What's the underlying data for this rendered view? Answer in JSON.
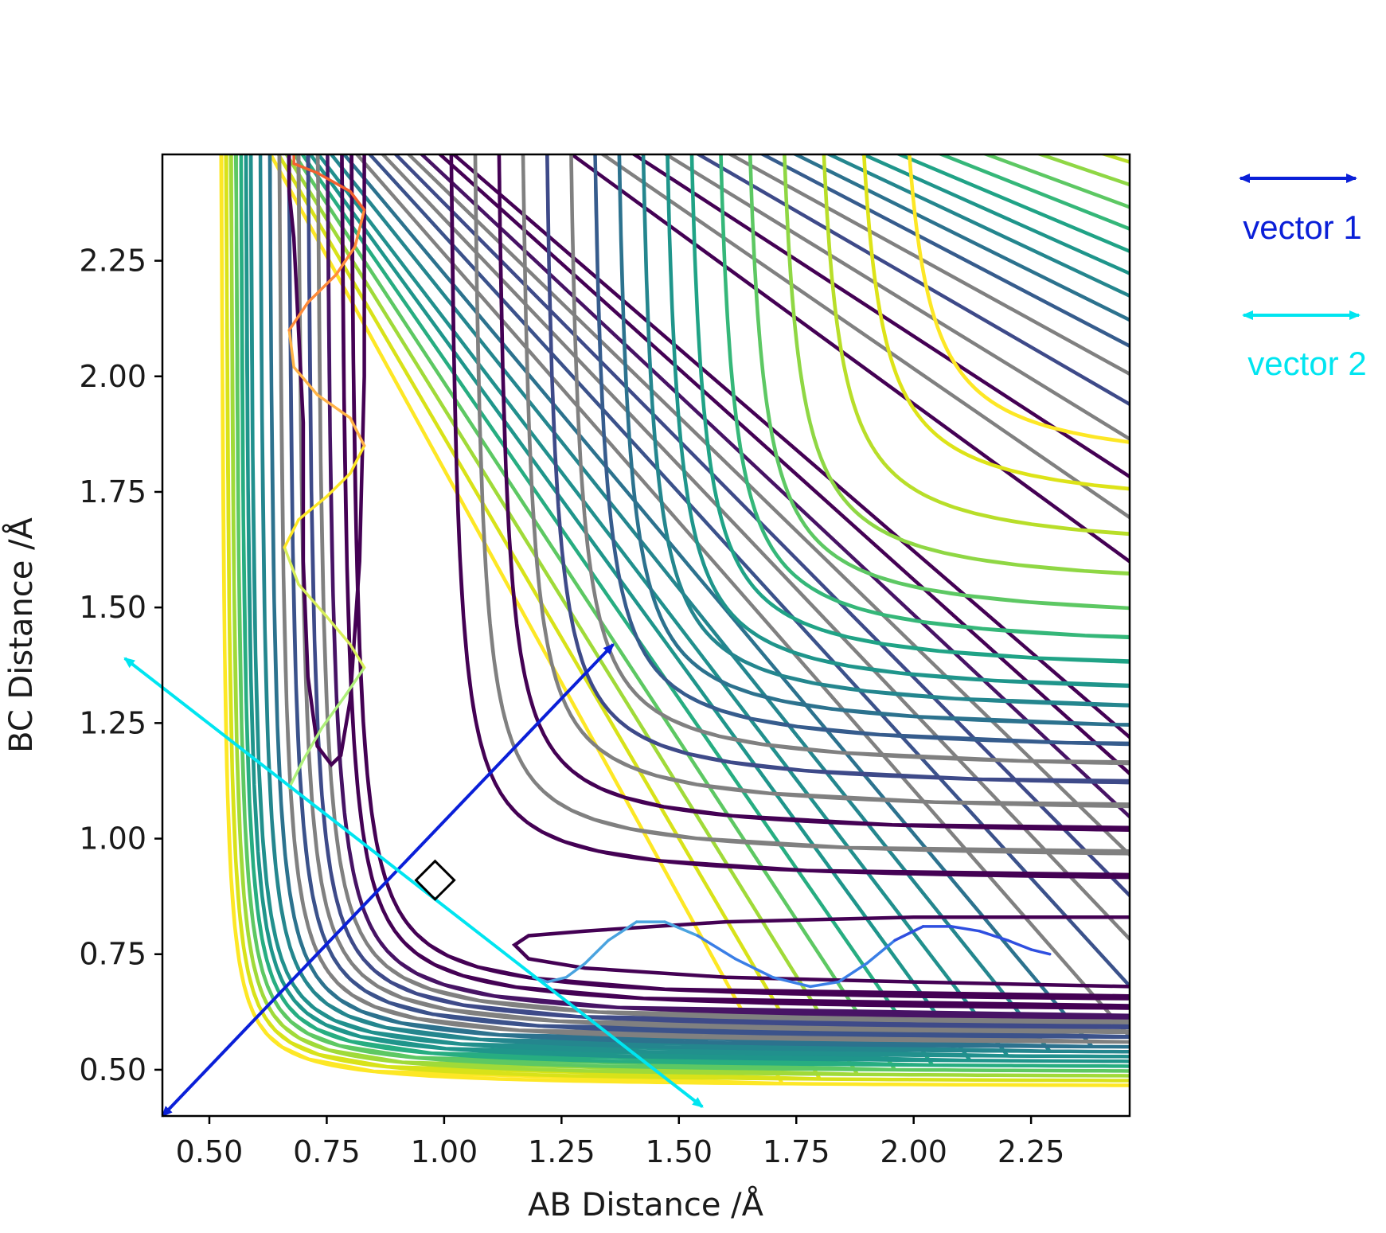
{
  "chart_data": {
    "type": "contour",
    "xlabel": "AB Distance /Å",
    "ylabel": "BC Distance /Å",
    "xlim": [
      0.4,
      2.46
    ],
    "ylim": [
      0.4,
      2.48
    ],
    "x_ticks": [
      "0.50",
      "0.75",
      "1.00",
      "1.25",
      "1.50",
      "1.75",
      "2.00",
      "2.25"
    ],
    "y_ticks": [
      "0.50",
      "0.75",
      "1.00",
      "1.25",
      "1.50",
      "1.75",
      "2.00",
      "2.25"
    ],
    "grid": false,
    "colormap": [
      "#440154",
      "#3b528b",
      "#21908d",
      "#5dc863",
      "#fde725"
    ],
    "contour_levels": [
      {
        "x_asym": 0.52,
        "y_asym": 0.46,
        "color": "#fde725"
      },
      {
        "x_asym": 0.53,
        "y_asym": 0.47,
        "color": "#d8e219"
      },
      {
        "x_asym": 0.54,
        "y_asym": 0.48,
        "color": "#a0da39"
      },
      {
        "x_asym": 0.55,
        "y_asym": 0.49,
        "color": "#5dc863"
      },
      {
        "x_asym": 0.56,
        "y_asym": 0.5,
        "color": "#27ad81"
      },
      {
        "x_asym": 0.57,
        "y_asym": 0.51,
        "color": "#1f958b"
      },
      {
        "x_asym": 0.58,
        "y_asym": 0.52,
        "color": "#21908d"
      },
      {
        "x_asym": 0.6,
        "y_asym": 0.53,
        "color": "#24868e"
      },
      {
        "x_asym": 0.62,
        "y_asym": 0.54,
        "color": "#2c728e"
      },
      {
        "x_asym": 0.64,
        "y_asym": 0.55,
        "color": "#808080"
      },
      {
        "x_asym": 0.66,
        "y_asym": 0.56,
        "color": "#3b528b"
      },
      {
        "x_asym": 0.68,
        "y_asym": 0.57,
        "color": "#808080"
      },
      {
        "x_asym": 0.7,
        "y_asym": 0.58,
        "color": "#3e4a89"
      },
      {
        "x_asym": 0.72,
        "y_asym": 0.59,
        "color": "#808080"
      },
      {
        "x_asym": 0.74,
        "y_asym": 0.6,
        "color": "#471365"
      },
      {
        "x_asym": 0.77,
        "y_asym": 0.62,
        "color": "#440154"
      },
      {
        "x_asym": 0.79,
        "y_asym": 0.64,
        "color": "#440154"
      },
      {
        "x_asym": 1.0,
        "y_asym": 0.9,
        "color": "#440154"
      },
      {
        "x_asym": 1.05,
        "y_asym": 0.95,
        "color": "#808080"
      },
      {
        "x_asym": 1.1,
        "y_asym": 1.0,
        "color": "#440154"
      },
      {
        "x_asym": 1.15,
        "y_asym": 1.05,
        "color": "#808080"
      },
      {
        "x_asym": 1.2,
        "y_asym": 1.1,
        "color": "#3e4a89"
      },
      {
        "x_asym": 1.25,
        "y_asym": 1.14,
        "color": "#808080"
      },
      {
        "x_asym": 1.3,
        "y_asym": 1.18,
        "color": "#365c8d"
      },
      {
        "x_asym": 1.35,
        "y_asym": 1.22,
        "color": "#2c728e"
      },
      {
        "x_asym": 1.4,
        "y_asym": 1.26,
        "color": "#24868e"
      },
      {
        "x_asym": 1.45,
        "y_asym": 1.3,
        "color": "#1f958b"
      },
      {
        "x_asym": 1.5,
        "y_asym": 1.35,
        "color": "#20a386"
      },
      {
        "x_asym": 1.56,
        "y_asym": 1.4,
        "color": "#35b779"
      },
      {
        "x_asym": 1.62,
        "y_asym": 1.46,
        "color": "#5dc863"
      },
      {
        "x_asym": 1.69,
        "y_asym": 1.53,
        "color": "#8fd744"
      },
      {
        "x_asym": 1.77,
        "y_asym": 1.61,
        "color": "#b8de29"
      },
      {
        "x_asym": 1.85,
        "y_asym": 1.7,
        "color": "#dde318"
      },
      {
        "x_asym": 1.94,
        "y_asym": 1.79,
        "color": "#fde725"
      }
    ],
    "trajectory_1": {
      "x": [
        0.67,
        0.7,
        0.74,
        0.79,
        0.83,
        0.8,
        0.75,
        0.69,
        0.66,
        0.69,
        0.75,
        0.8,
        0.83,
        0.8,
        0.73,
        0.68,
        0.67,
        0.71,
        0.77,
        0.81,
        0.83,
        0.8,
        0.73,
        0.68,
        0.68
      ],
      "y": [
        1.11,
        1.17,
        1.24,
        1.31,
        1.37,
        1.42,
        1.48,
        1.55,
        1.63,
        1.69,
        1.74,
        1.79,
        1.85,
        1.91,
        1.96,
        2.02,
        2.1,
        2.16,
        2.22,
        2.28,
        2.36,
        2.4,
        2.44,
        2.46,
        2.48
      ],
      "colors": [
        "#aef07a",
        "#d8ef5a",
        "#fde725",
        "#ffb347",
        "#ff8c3a",
        "#f5612f"
      ]
    },
    "trajectory_2": {
      "x": [
        1.19,
        1.22,
        1.26,
        1.3,
        1.35,
        1.41,
        1.47,
        1.54,
        1.62,
        1.7,
        1.78,
        1.84,
        1.9,
        1.96,
        2.02,
        2.08,
        2.14,
        2.2,
        2.25,
        2.29
      ],
      "y": [
        0.7,
        0.69,
        0.7,
        0.73,
        0.78,
        0.82,
        0.82,
        0.79,
        0.74,
        0.7,
        0.68,
        0.69,
        0.73,
        0.78,
        0.81,
        0.81,
        0.8,
        0.78,
        0.76,
        0.75
      ],
      "colors": [
        "#4aa3df",
        "#3a7ee6",
        "#2f4fe0"
      ]
    },
    "vectors": [
      {
        "name": "vector 1",
        "color": "#0a1fd8",
        "start": [
          0.4,
          0.4
        ],
        "end": [
          1.36,
          1.42
        ]
      },
      {
        "name": "vector 2",
        "color": "#00e5f0",
        "start": [
          0.32,
          1.39
        ],
        "end": [
          1.55,
          0.42
        ]
      }
    ],
    "right_angle_marker": {
      "at": [
        0.94,
        0.91
      ]
    }
  }
}
